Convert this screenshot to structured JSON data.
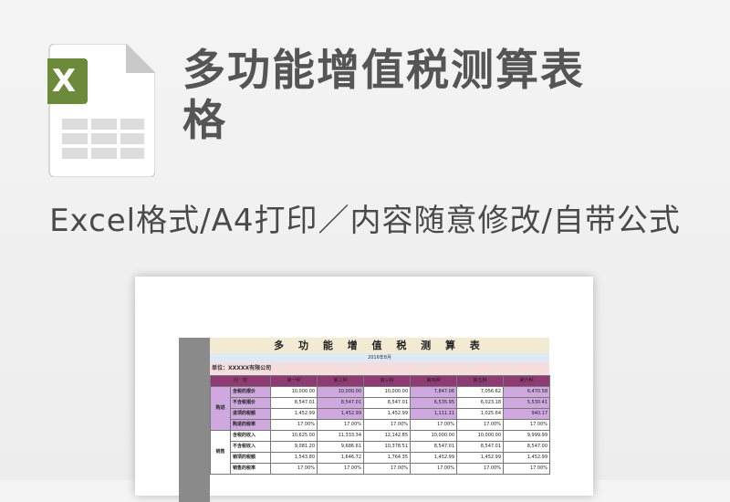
{
  "header": {
    "title": "多功能增值税测算表格",
    "subtitle": "Excel格式/A4打印／内容随意修改/自带公式"
  },
  "icon": {
    "name": "excel-file-icon",
    "badge": "X",
    "accent": "#6b8a3a"
  },
  "sheet": {
    "title": "多 功 能 增 值 税 测 算 表",
    "date": "2016年8月",
    "company": "单位：XXXXX有限公司",
    "columns": [
      "内　容",
      "",
      "第一种",
      "第二种",
      "第三种",
      "第四种",
      "第五种",
      "第六种"
    ],
    "groups": [
      {
        "label": "购进",
        "rows": [
          {
            "label": "含税的报价",
            "values": [
              "10,000.00",
              "10,000.00",
              "10,000.00",
              "7,847.06",
              "7,056.62",
              "6,470.58"
            ]
          },
          {
            "label": "不含税报价",
            "values": [
              "8,547.01",
              "8,547.01",
              "8,547.01",
              "6,535.95",
              "6,023.18",
              "5,530.41"
            ]
          },
          {
            "label": "进项的税额",
            "values": [
              "1,452.99",
              "1,452.99",
              "1,452.99",
              "1,111.11",
              "1,025.64",
              "940.17"
            ]
          },
          {
            "label": "购进的税率",
            "values": [
              "17.00%",
              "17.00%",
              "17.00%",
              "17.00%",
              "17.00%",
              "17.00%"
            ]
          }
        ]
      },
      {
        "label": "销售",
        "rows": [
          {
            "label": "含税的收入",
            "values": [
              "10,625.00",
              "11,333.34",
              "12,142.85",
              "10,000.00",
              "10,000.00",
              "9,999.99"
            ]
          },
          {
            "label": "不含税收入",
            "values": [
              "9,081.20",
              "9,686.61",
              "10,378.51",
              "8,547.01",
              "8,547.01",
              "8,547.00"
            ]
          },
          {
            "label": "销项的税额",
            "values": [
              "1,543.80",
              "1,646.72",
              "1,764.35",
              "1,452.99",
              "1,452.99",
              "1,452.99"
            ]
          },
          {
            "label": "销售的税率",
            "values": [
              "17.00%",
              "17.00%",
              "17.00%",
              "17.00%",
              "17.00%",
              "17.00%"
            ]
          }
        ]
      }
    ]
  }
}
